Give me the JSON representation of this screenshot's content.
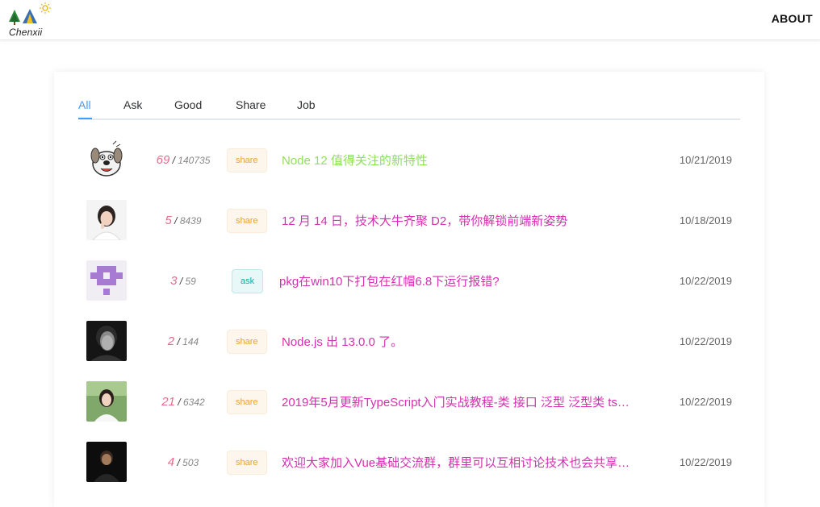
{
  "header": {
    "logo_text": "Chenxii",
    "about_label": "ABOUT"
  },
  "tabs": [
    {
      "label": "All",
      "active": true
    },
    {
      "label": "Ask",
      "active": false
    },
    {
      "label": "Good",
      "active": false
    },
    {
      "label": "Share",
      "active": false
    },
    {
      "label": "Job",
      "active": false
    }
  ],
  "topics": [
    {
      "avatar": "cartoon-dog-avatar",
      "reply_count": "69",
      "visit_count": "140735",
      "tag": "share",
      "title": "Node 12 值得关注的新特性",
      "date": "10/21/2019"
    },
    {
      "avatar": "woman-avatar",
      "reply_count": "5",
      "visit_count": "8439",
      "tag": "share",
      "title": "12 月 14 日，技术大牛齐聚 D2，带你解锁前端新姿势",
      "date": "10/18/2019"
    },
    {
      "avatar": "identicon-avatar",
      "reply_count": "3",
      "visit_count": "59",
      "tag": "ask",
      "title": "pkg在win10下打包在红帽6.8下运行报错?",
      "date": "10/22/2019"
    },
    {
      "avatar": "man-portrait-avatar",
      "reply_count": "2",
      "visit_count": "144",
      "tag": "share",
      "title": "Node.js 出 13.0.0 了。",
      "date": "10/22/2019"
    },
    {
      "avatar": "woman-outdoor-avatar",
      "reply_count": "21",
      "visit_count": "6342",
      "tag": "share",
      "title": "2019年5月更新TypeScript入门实战教程-类 接口 泛型 泛型类 ts…",
      "date": "10/22/2019"
    },
    {
      "avatar": "person-dark-avatar",
      "reply_count": "4",
      "visit_count": "503",
      "tag": "share",
      "title": "欢迎大家加入Vue基础交流群，群里可以互相讨论技术也会共享…",
      "date": "10/22/2019"
    }
  ],
  "colors": {
    "accent": "#409eff",
    "title_link": "#d62fb0",
    "title_first": "#8ee05a",
    "reply_count": "#e96b8a",
    "share_tag": "#e6a23c",
    "ask_tag": "#13a8a8"
  }
}
